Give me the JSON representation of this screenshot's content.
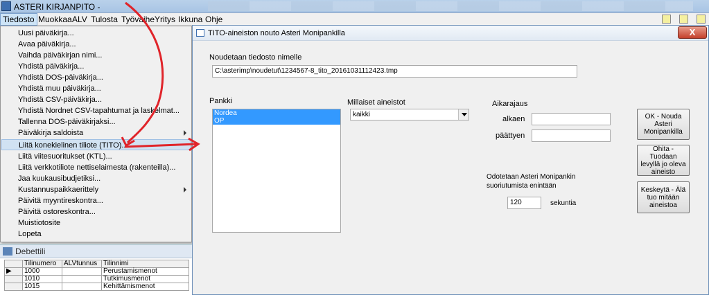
{
  "app": {
    "title": "ASTERI KIRJANPITO -"
  },
  "menubar": [
    "Tiedosto",
    "Muokkaa",
    "ALV",
    "Tulosta",
    "Työvaihe",
    "Yritys",
    "Ikkuna",
    "Ohje"
  ],
  "file_menu": [
    {
      "label": "Uusi päiväkirja..."
    },
    {
      "label": "Avaa päiväkirja..."
    },
    {
      "label": "Vaihda päiväkirjan nimi..."
    },
    {
      "label": "Yhdistä päiväkirja..."
    },
    {
      "label": "Yhdistä DOS-päiväkirja..."
    },
    {
      "label": "Yhdistä muu päiväkirja..."
    },
    {
      "label": "Yhdistä CSV-päiväkirja..."
    },
    {
      "label": "Yhdistä Nordnet CSV-tapahtumat ja laskelmat..."
    },
    {
      "label": "Tallenna DOS-päiväkirjaksi..."
    },
    {
      "label": "Päiväkirja saldoista",
      "submenu": true
    },
    {
      "label": "Liitä konekielinen tiliote (TITO)...",
      "highlighted": true
    },
    {
      "label": "Liitä viitesuoritukset (KTL)..."
    },
    {
      "label": "Liitä verkkotiliote nettiselaimesta (rakenteilla)..."
    },
    {
      "label": "Jaa kuukausibudjetiksi..."
    },
    {
      "label": "Kustannuspaikkaerittely",
      "submenu": true
    },
    {
      "label": "Päivitä myyntireskontra..."
    },
    {
      "label": "Päivitä ostoreskontra..."
    },
    {
      "label": "Muistiotosite"
    },
    {
      "label": "Lopeta"
    }
  ],
  "debettili": {
    "title": "Debettili",
    "columns": [
      "Tilinumero",
      "ALVtunnus",
      "Tilinnimi"
    ],
    "rows": [
      {
        "cells": [
          "1000",
          "",
          "Perustamismenot"
        ],
        "current": true
      },
      {
        "cells": [
          "1010",
          "",
          "Tutkimusmenot"
        ],
        "current": false
      },
      {
        "cells": [
          "1015",
          "",
          "Kehittämismenot"
        ],
        "current": false
      }
    ]
  },
  "dialog": {
    "title": "TITO-aineiston nouto Asteri Monipankilla",
    "close_label": "X",
    "filename_label": "Noudetaan tiedosto nimelle",
    "filename_value": "C:\\asterimp\\noudetut\\1234567-8_tito_20161031112423.tmp",
    "pankki_label": "Pankki",
    "banks": [
      "Nordea",
      "OP"
    ],
    "aineistot_label": "Millaiset aineistot",
    "aineistot_value": "kaikki",
    "aikarajaus_label": "Aikarajaus",
    "alkaen_label": "alkaen",
    "alkaen_value": "",
    "paattyen_label": "päättyen",
    "paattyen_value": "",
    "wait_label": "Odotetaan Asteri Monipankin suoriutumista enintään",
    "wait_value": "120",
    "seconds_label": "sekuntia",
    "btn_ok": "OK - Nouda\nAsteri\nMonipankilla",
    "btn_skip": "Ohita - Tuodaan\nlevyllä jo oleva\naineisto",
    "btn_cancel": "Keskeytä - Älä\ntuo mitään\naineistoa"
  },
  "colors": {
    "highlight": "#3399ff",
    "annotation_arrow": "#e0242a",
    "menu_highlight": "#d1e2f2"
  }
}
